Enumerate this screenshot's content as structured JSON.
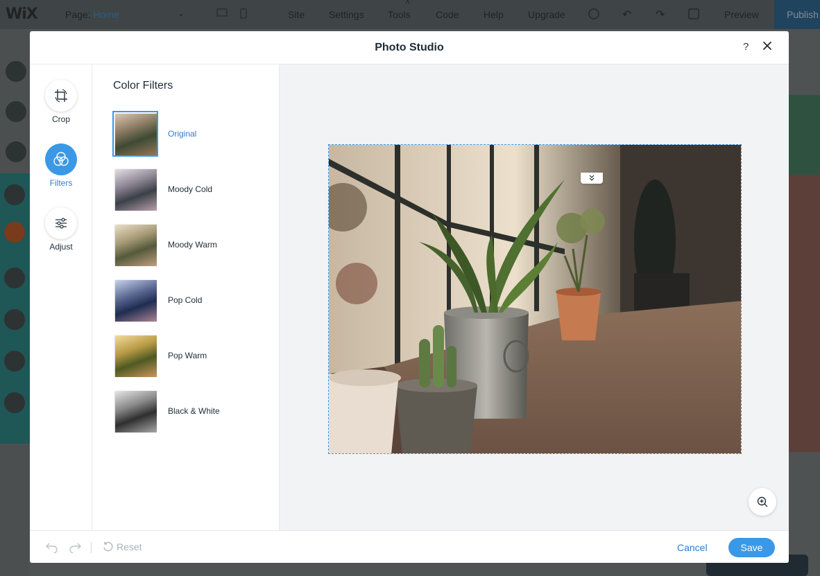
{
  "editor": {
    "logo": "WiX",
    "page_label": "Page:",
    "page_value": "Home",
    "menu": [
      "Site",
      "Settings",
      "Tools",
      "Code",
      "Help",
      "Upgrade"
    ],
    "preview_label": "Preview",
    "publish_label": "Publish"
  },
  "modal": {
    "title": "Photo Studio",
    "help_label": "?"
  },
  "tools": [
    {
      "label": "Crop",
      "icon": "crop-icon",
      "active": false
    },
    {
      "label": "Filters",
      "icon": "filters-icon",
      "active": true
    },
    {
      "label": "Adjust",
      "icon": "adjust-sliders-icon",
      "active": false
    }
  ],
  "filters_panel": {
    "title": "Color Filters",
    "items": [
      {
        "label": "Original",
        "selected": true
      },
      {
        "label": "Moody Cold",
        "selected": false
      },
      {
        "label": "Moody Warm",
        "selected": false
      },
      {
        "label": "Pop Cold",
        "selected": false
      },
      {
        "label": "Pop Warm",
        "selected": false
      },
      {
        "label": "Black & White",
        "selected": false
      }
    ]
  },
  "footer": {
    "reset_label": "Reset",
    "cancel_label": "Cancel",
    "save_label": "Save"
  },
  "colors": {
    "accent": "#3b98e6",
    "accent_text": "#2a7dd1",
    "title_text": "#1f2b35"
  }
}
